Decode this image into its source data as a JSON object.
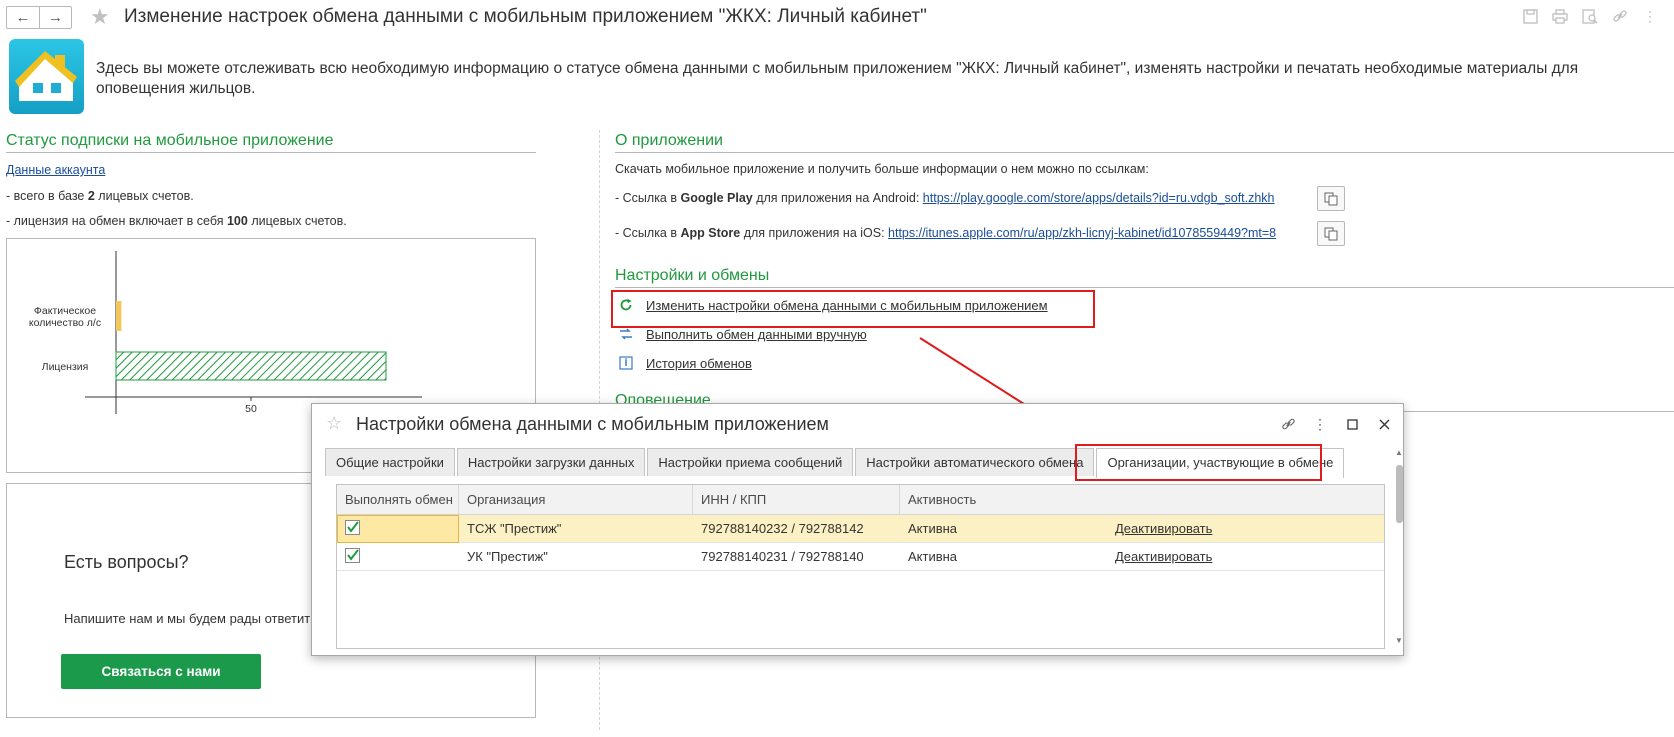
{
  "window": {
    "title": "Изменение настроек обмена данными с мобильным приложением \"ЖКХ: Личный кабинет\"",
    "back_icon": "arrow-left-icon",
    "forward_icon": "arrow-right-icon"
  },
  "header": {
    "intro": "Здесь вы можете отслеживать всю необходимую информацию о статусе обмена данными с мобильным приложением \"ЖКХ: Личный кабинет\", изменять настройки и печатать необходимые материалы для оповещения жильцов."
  },
  "subscription": {
    "title": "Статус подписки на мобильное приложение",
    "account_link": "Данные аккаунта",
    "accounts_prefix": "- всего в базе ",
    "accounts_count": "2",
    "accounts_suffix": " лицевых счетов.",
    "license_prefix": "- лицензия на обмен включает в себя ",
    "license_count": "100",
    "license_suffix": " лицевых счетов."
  },
  "chart_data": {
    "type": "bar",
    "orientation": "horizontal",
    "categories": [
      "Фактическое количество л/с",
      "Лицензия"
    ],
    "values": [
      2,
      100
    ],
    "xlim": [
      0,
      110
    ],
    "xticks": [
      "50"
    ],
    "colors": {
      "actual": "#f2c75c",
      "license": "#1f9a3e"
    }
  },
  "questions": {
    "title": "Есть вопросы?",
    "text": "Напишите нам и мы будем рады ответить",
    "button": "Связаться с нами"
  },
  "about": {
    "title": "О приложении",
    "intro": "Скачать мобильное приложение и получить больше информации о нем можно по ссылкам:",
    "google_prefix": "- Ссылка в ",
    "google_store": "Google Play",
    "google_suffix": " для приложения на Android: ",
    "google_url": "https://play.google.com/store/apps/details?id=ru.vdgb_soft.zhkh",
    "apple_prefix": "- Ссылка в ",
    "apple_store": "App Store",
    "apple_suffix": " для приложения на iOS: ",
    "apple_url": "https://itunes.apple.com/ru/app/zkh-licnyj-kabinet/id1078559449?mt=8"
  },
  "settings": {
    "title": "Настройки и обмены",
    "actions": [
      {
        "label": "Изменить настройки обмена данными с мобильным приложением",
        "icon": "refresh-icon"
      },
      {
        "label": "Выполнить обмен данными вручную",
        "icon": "exchange-icon"
      },
      {
        "label": "История обменов",
        "icon": "history-icon"
      }
    ]
  },
  "notify": {
    "title": "Оповещение"
  },
  "modal": {
    "title": "Настройки обмена данными с мобильным приложением",
    "tabs": [
      "Общие настройки",
      "Настройки загрузки данных",
      "Настройки приема сообщений",
      "Настройки автоматического обмена",
      "Организации, участвующие в обмене"
    ],
    "columns": [
      "Выполнять обмен",
      "Организация",
      "ИНН / КПП",
      "Активность"
    ],
    "rows": [
      {
        "org": "ТСЖ \"Престиж\"",
        "inn": "792788140232 / 792788142",
        "status": "Активна",
        "action": "Деактивировать"
      },
      {
        "org": "УК \"Престиж\"",
        "inn": "792788140231 / 792788140",
        "status": "Активна",
        "action": "Деактивировать"
      }
    ]
  },
  "colors": {
    "accent_green": "#1f9a3e",
    "highlight_red": "#e01b1b",
    "selected_row": "#fcf1c4"
  }
}
